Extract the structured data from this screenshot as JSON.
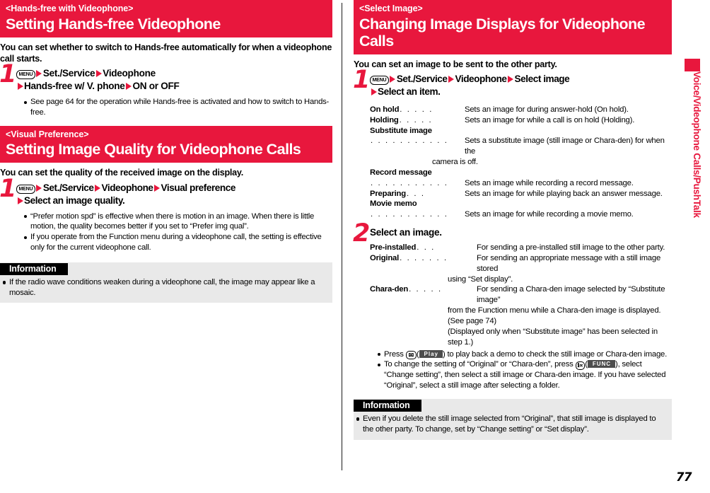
{
  "page": {
    "number": "77",
    "side_tab_text": "Voice/Videophone Calls/PushTalk",
    "accent_color": "#e8173d"
  },
  "left_column": {
    "sections": [
      {
        "kicker": "<Hands-free with Videophone>",
        "title": "Setting Hands-free Videophone",
        "lead": "You can set whether to switch to Hands-free automatically for when a videophone call starts.",
        "step_number": "1",
        "step_key": "MENU",
        "step_parts": [
          "Set./Service",
          "Videophone"
        ],
        "step_parts_line2": [
          "Hands-free w/ V. phone",
          "ON or OFF"
        ],
        "bullets": [
          "See page 64 for the operation while Hands-free is activated and how to switch to Hands-free."
        ]
      },
      {
        "kicker": "<Visual Preference>",
        "title": "Setting Image Quality for Videophone Calls",
        "lead": "You can set the quality of the received image on the display.",
        "step_number": "1",
        "step_key": "MENU",
        "step_parts": [
          "Set./Service",
          "Videophone",
          "Visual preference"
        ],
        "step_parts_line2": [
          "Select an image quality."
        ],
        "bullets": [
          "“Prefer motion spd” is effective when there is motion in an image. When there is little motion, the quality becomes better if you set to “Prefer img qual”.",
          "If you operate from the Function menu during a videophone call, the setting is effective only for the current videophone call."
        ]
      }
    ],
    "information": {
      "label": "Information",
      "bullets": [
        "If the radio wave conditions weaken during a videophone call, the image may appear like a mosaic."
      ]
    }
  },
  "right_column": {
    "section": {
      "kicker": "<Select Image>",
      "title": "Changing Image Displays for Videophone Calls",
      "lead": "You can set an image to be sent to the other party.",
      "step1_number": "1",
      "step1_key": "MENU",
      "step1_parts": [
        "Set./Service",
        "Videophone",
        "Select image"
      ],
      "step1_parts_line2": [
        "Select an item."
      ],
      "items_step1": [
        {
          "term": "On hold",
          "leader": ". . . . .",
          "desc": "Sets an image for during answer-hold (On hold)."
        },
        {
          "term": "Holding",
          "leader": ". . . . .",
          "desc": "Sets an image for while a call is on hold (Holding)."
        },
        {
          "term": "Substitute image",
          "leader": "",
          "desc": ""
        },
        {
          "term": "",
          "leader": ". . . . . . . . . . .",
          "desc": "Sets a substitute image (still image or Chara-den) for when the",
          "cont": "camera is off."
        },
        {
          "term": "Record message",
          "leader": "",
          "desc": ""
        },
        {
          "term": "",
          "leader": ". . . . . . . . . . .",
          "desc": "Sets an image while recording a record message."
        },
        {
          "term": "Preparing",
          "leader": ". . .",
          "desc": "Sets an image for while playing back an answer message."
        },
        {
          "term": "Movie memo",
          "leader": "",
          "desc": ""
        },
        {
          "term": "",
          "leader": ". . . . . . . . . . .",
          "desc": "Sets an image for while recording a movie memo."
        }
      ],
      "step2_number": "2",
      "step2_title": "Select an image.",
      "items_step2": [
        {
          "term": "Pre-installed",
          "leader": ". . .",
          "desc": "For sending a pre-installed still image to the other party."
        },
        {
          "term": "Original",
          "leader": ". . . . . . .",
          "desc": "For sending an appropriate message with a still image stored",
          "cont": [
            "using “Set display”."
          ]
        },
        {
          "term": "Chara-den",
          "leader": ". . . . .",
          "desc": "For sending a Chara-den image selected by “Substitute image”",
          "cont": [
            "from the Function menu while a Chara-den image is displayed.",
            "(See page 74)",
            "(Displayed only when “Substitute image” has been selected in",
            "step 1.)"
          ]
        }
      ],
      "bullets": {
        "b1_pre": "Press",
        "b1_key": "✉",
        "b1_softkey": "Play",
        "b1_post": ") to play back a demo to check the still image or Chara-den image.",
        "b2_pre": "To change the setting of “Original” or “Chara-den”, press",
        "b2_key": "ℹ∝",
        "b2_softkey": "FUNC",
        "b2_post": "), select “Change setting”, then select a still image or Chara-den image. If you have selected “Original”, select a still image after selecting a folder."
      }
    },
    "information": {
      "label": "Information",
      "bullets": [
        "Even if you delete the still image selected from “Original”, that still image is displayed to the other party. To change, set by “Change setting” or “Set display”."
      ]
    }
  }
}
